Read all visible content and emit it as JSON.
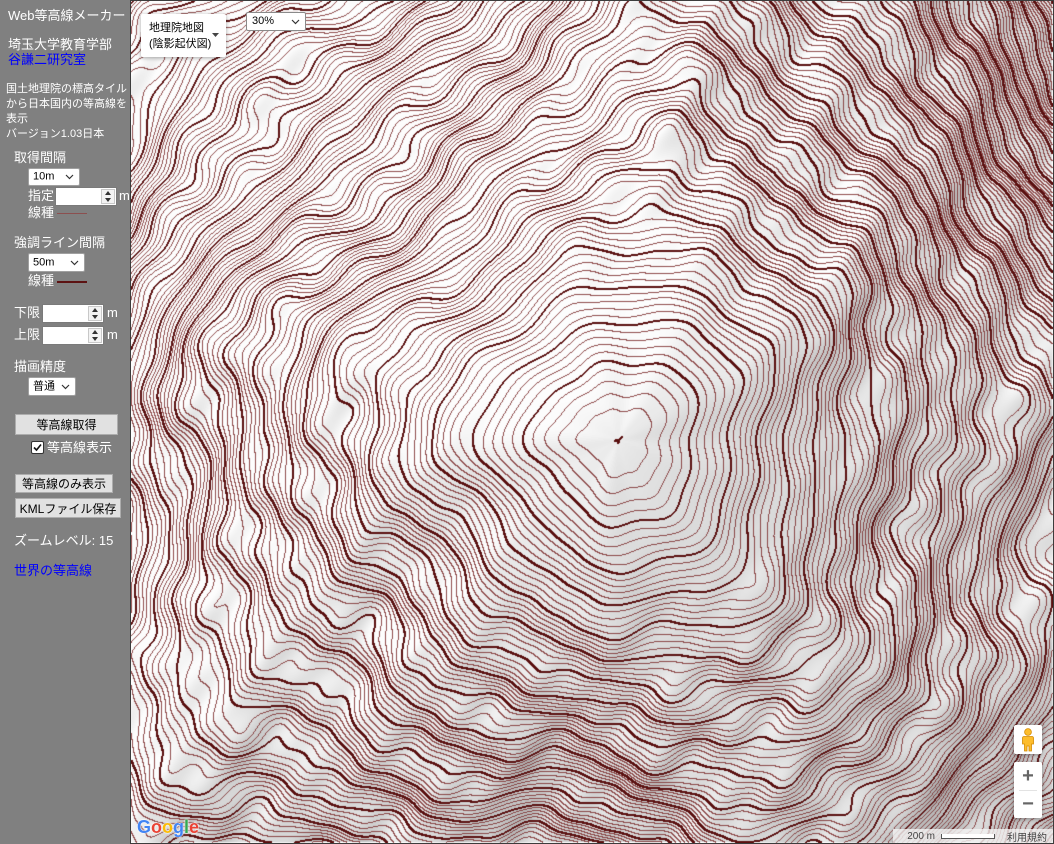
{
  "sidebar": {
    "background": "#808080",
    "link_color": "#0000ff",
    "title": "Web等高線メーカー",
    "affiliation": "埼玉大学教育学部",
    "lab_link": "谷謙二研究室",
    "description_lines": [
      "国土地理院の標高タイル",
      "から日本国内の等高線を",
      "表示",
      "バージョン1.03日本"
    ],
    "interval": {
      "label": "取得間隔",
      "selected": "10m",
      "custom_label": "指定",
      "custom_value": "",
      "unit": "m",
      "line_type_label": "線種",
      "line_color": "#8c4f4f"
    },
    "emphasis": {
      "label": "強調ライン間隔",
      "selected": "50m",
      "line_type_label": "線種",
      "line_color": "#5c1212"
    },
    "range": {
      "lower_label": "下限",
      "lower_value": "",
      "upper_label": "上限",
      "upper_value": "",
      "unit": "m"
    },
    "precision": {
      "label": "描画精度",
      "selected": "普通"
    },
    "fetch_button": "等高線取得",
    "show_contours": {
      "label": "等高線表示",
      "checked": true
    },
    "contours_only_button": "等高線のみ表示",
    "kml_button": "KMLファイル保存",
    "zoom_level_text": "ズームレベル: 15",
    "world_link": "世界の等高線"
  },
  "map": {
    "map_type": {
      "line1": "地理院地図",
      "line2": "(陰影起伏図)"
    },
    "opacity_select": "30%",
    "zoom_in": "+",
    "zoom_out": "−",
    "logo_letters": [
      "G",
      "o",
      "o",
      "g",
      "l",
      "e"
    ],
    "logo_colors": [
      "#4285f4",
      "#ea4335",
      "#fbbc05",
      "#4285f4",
      "#34a853",
      "#ea4335"
    ],
    "scale_label": "200 m",
    "terms_link": "利用規約",
    "contour_color": "#7d2e2e",
    "index_contour_color": "#5a1010",
    "icons": {
      "select_chevron": "chevron-down-icon",
      "map_type_dropdown": "triangle-down-icon",
      "street_view": "pegman-icon",
      "spinner": "spin-up-icon / spin-down-icon",
      "checkbox": "checkmark-icon"
    }
  }
}
